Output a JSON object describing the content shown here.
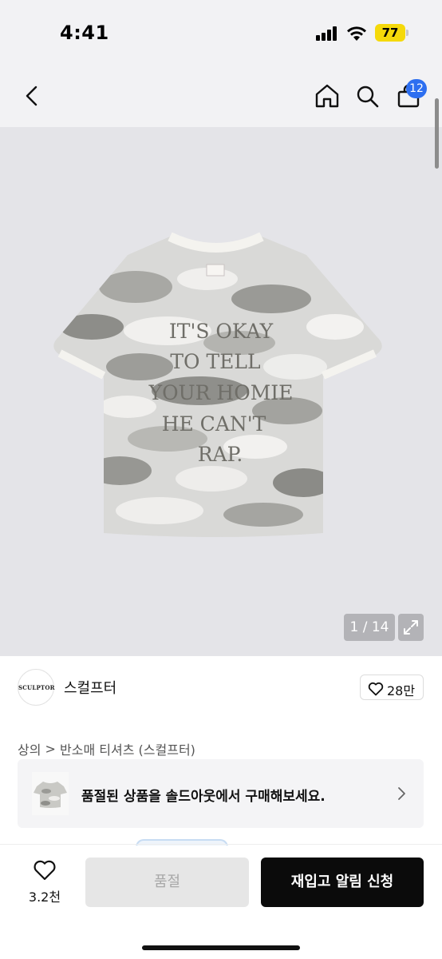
{
  "status_bar": {
    "time": "4:41",
    "battery_level": "77",
    "battery_color": "#f5d90a",
    "icons": [
      "signal-icon",
      "wifi-icon",
      "battery-icon"
    ]
  },
  "nav": {
    "back_icon": "chevron-left-icon",
    "home_icon": "home-icon",
    "search_icon": "search-icon",
    "cart_icon": "shopping-bag-icon",
    "cart_badge": "12",
    "badge_color": "#2d6ff0"
  },
  "product_image": {
    "shirt_text_lines": [
      "IT'S OKAY",
      "TO TELL",
      "YOUR HOMIE",
      "HE CAN'T",
      "RAP."
    ],
    "counter": "1 / 14",
    "expand_icon": "expand-icon"
  },
  "brand": {
    "logo_text": "SCULPTOR",
    "name": "스컬프터",
    "like_icon": "heart-outline-icon",
    "like_count": "28만"
  },
  "breadcrumb": {
    "category": "상의",
    "separator": ">",
    "subcategory": "반소매 티셔츠 (스컬프터)"
  },
  "soldout_banner": {
    "text": "품절된 상품을 솔드아웃에서 구매해보세요.",
    "arrow_icon": "chevron-right-icon"
  },
  "bottom_bar": {
    "wish_icon": "heart-outline-icon",
    "wish_count": "3.2천",
    "soldout_label": "품절",
    "restock_label": "재입고 알림 신청",
    "primary_color": "#0b0b0b"
  }
}
